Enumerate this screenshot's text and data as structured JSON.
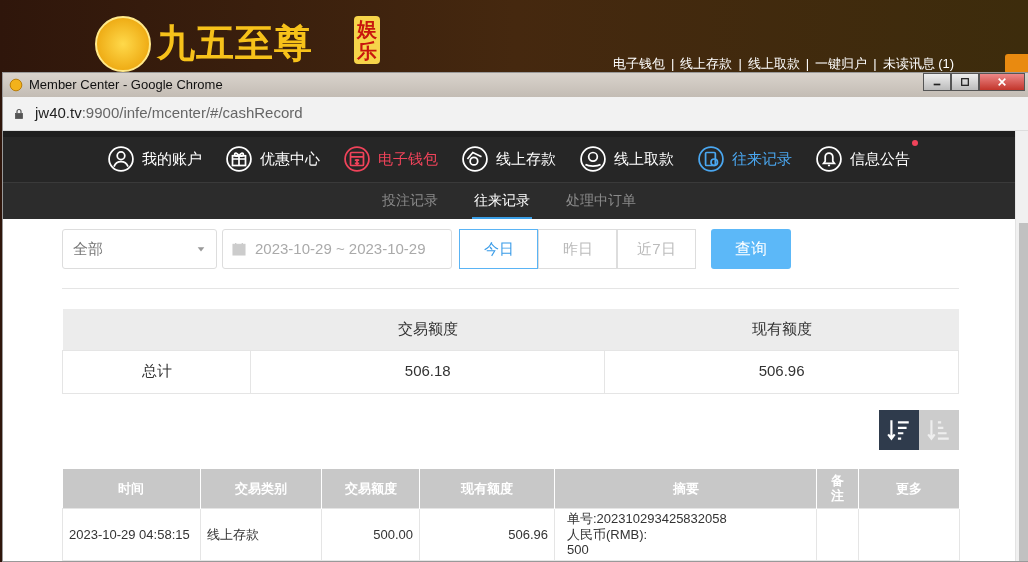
{
  "background_site": {
    "logo_text": "九五至尊",
    "logo_badge": "娱乐",
    "separator": "|",
    "links": [
      "电子钱包",
      "线上存款",
      "线上取款",
      "一键归户",
      "未读讯息 (1)"
    ]
  },
  "window": {
    "title": "Member Center - Google Chrome",
    "url_host": "jw40.tv",
    "url_rest": ":9900/infe/mcenter/#/cashRecord"
  },
  "nav": [
    {
      "label": "我的账户",
      "kind": "user",
      "selected": false,
      "highlighted": false,
      "unread": false
    },
    {
      "label": "优惠中心",
      "kind": "gift",
      "selected": false,
      "highlighted": false,
      "unread": false
    },
    {
      "label": "电子钱包",
      "kind": "wallet",
      "selected": true,
      "highlighted": false,
      "unread": false
    },
    {
      "label": "线上存款",
      "kind": "deposit",
      "selected": false,
      "highlighted": false,
      "unread": false
    },
    {
      "label": "线上取款",
      "kind": "withdraw",
      "selected": false,
      "highlighted": false,
      "unread": false
    },
    {
      "label": "往来记录",
      "kind": "record",
      "selected": false,
      "highlighted": true,
      "unread": false
    },
    {
      "label": "信息公告",
      "kind": "bell",
      "selected": false,
      "highlighted": false,
      "unread": true
    }
  ],
  "subtabs": [
    {
      "label": "投注记录",
      "selected": false
    },
    {
      "label": "往来记录",
      "selected": true
    },
    {
      "label": "处理中订单",
      "selected": false
    }
  ],
  "filter": {
    "type_select": "全部",
    "date_range": "2023-10-29 ~ 2023-10-29",
    "quick_ranges": [
      {
        "label": "今日",
        "selected": true
      },
      {
        "label": "昨日",
        "selected": false
      },
      {
        "label": "近7日",
        "selected": false
      }
    ],
    "search_button": "查询"
  },
  "summary": {
    "columns": [
      "交易额度",
      "现有额度"
    ],
    "rows": [
      {
        "label": "总计",
        "cells": [
          "506.18",
          "506.96"
        ]
      }
    ]
  },
  "sort_buttons": [
    {
      "kind": "desc",
      "selected": true
    },
    {
      "kind": "asc",
      "selected": false
    }
  ],
  "table": {
    "columns": [
      "时间",
      "交易类别",
      "交易额度",
      "现有额度",
      "摘要",
      "备注",
      "更多"
    ],
    "rows": [
      {
        "time": "2023-10-29 04:58:15",
        "type": "线上存款",
        "amount": "500.00",
        "balance": "506.96",
        "summary_lines": [
          "单号:202310293425832058",
          "人民币(RMB):",
          "500"
        ]
      }
    ]
  }
}
